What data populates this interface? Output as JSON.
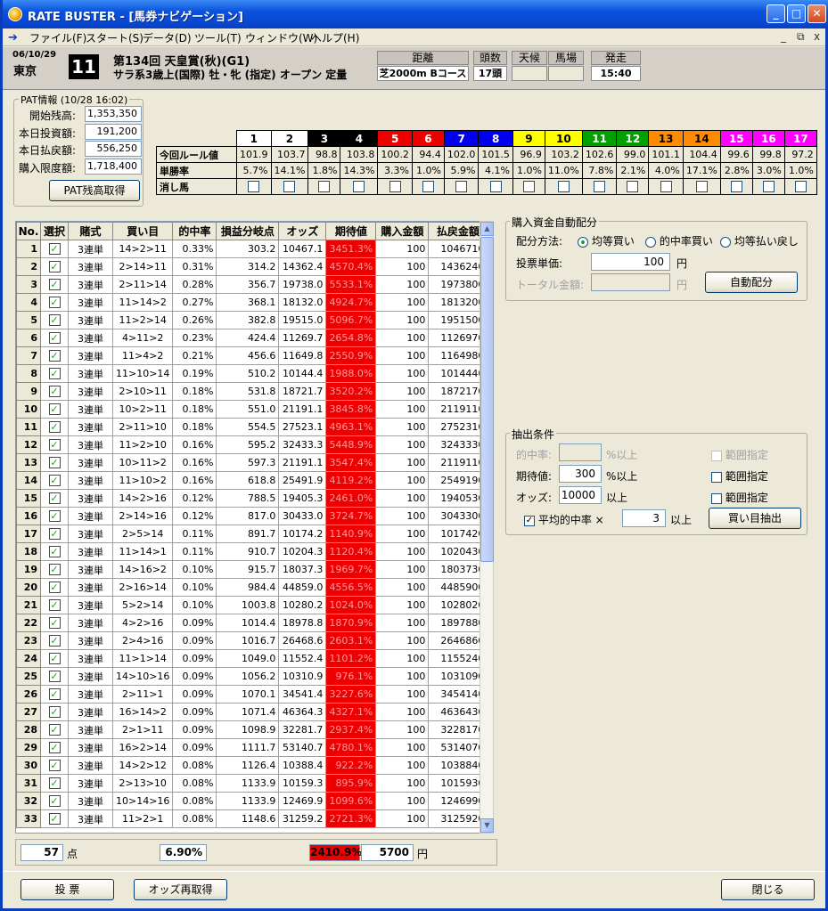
{
  "window": {
    "title": "RATE BUSTER - [馬券ナビゲーション]",
    "min": "_",
    "max": "□",
    "close": "✕"
  },
  "menu": [
    "ファイル(F)",
    "スタート(S)",
    "データ(D)",
    "ツール(T)",
    "ウィンドウ(W)",
    "ヘルプ(H)"
  ],
  "mdi": {
    "min": "_",
    "restore": "⧉",
    "close": "x"
  },
  "race": {
    "date": "06/10/29",
    "place": "東京",
    "number": "11",
    "name": "第134回 天皇賞(秋)(G1)",
    "conditions": "サラ系3歳上(国際) 牡・牝 (指定) オープン 定量",
    "distance_label": "距離",
    "distance": "芝2000m Bコース",
    "heads_label": "頭数",
    "heads": "17頭",
    "weather_label": "天候",
    "weather": "",
    "track_label": "馬場",
    "track": "",
    "start_label": "発走",
    "start": "15:40"
  },
  "pat": {
    "legend": "PAT情報 (10/28 16:02)",
    "rows": [
      {
        "label": "開始残高:",
        "value": "1,353,350"
      },
      {
        "label": "本日投資額:",
        "value": "191,200"
      },
      {
        "label": "本日払戻額:",
        "value": "556,250"
      },
      {
        "label": "購入限度額:",
        "value": "1,718,400"
      }
    ],
    "button": "PAT残高取得"
  },
  "horses": {
    "row_labels": [
      "今回ルール値",
      "単勝率",
      "消し馬"
    ],
    "numbers": [
      "1",
      "2",
      "3",
      "4",
      "5",
      "6",
      "7",
      "8",
      "9",
      "10",
      "11",
      "12",
      "13",
      "14",
      "15",
      "16",
      "17"
    ],
    "colors": [
      "#ffffff",
      "#ffffff",
      "#000000",
      "#000000",
      "#ee0000",
      "#ee0000",
      "#0000ee",
      "#0000ee",
      "#ffff00",
      "#ffff00",
      "#00a000",
      "#00a000",
      "#ff8c00",
      "#ff8c00",
      "#ff00ff",
      "#ff00ff",
      "#ff00ff"
    ],
    "text_colors": [
      "#000000",
      "#000000",
      "#ffffff",
      "#ffffff",
      "#ffffff",
      "#ffffff",
      "#ffffff",
      "#ffffff",
      "#000000",
      "#000000",
      "#ffffff",
      "#ffffff",
      "#000000",
      "#000000",
      "#ffffff",
      "#ffffff",
      "#ffffff"
    ],
    "rule_values": [
      "101.9",
      "103.7",
      "98.8",
      "103.8",
      "100.2",
      "94.4",
      "102.0",
      "101.5",
      "96.9",
      "103.2",
      "102.6",
      "99.0",
      "101.1",
      "104.4",
      "99.6",
      "99.8",
      "97.2"
    ],
    "win_rates": [
      "5.7%",
      "14.1%",
      "1.8%",
      "14.3%",
      "3.3%",
      "1.0%",
      "5.9%",
      "4.1%",
      "1.0%",
      "11.0%",
      "7.8%",
      "2.1%",
      "4.0%",
      "17.1%",
      "2.8%",
      "3.0%",
      "1.0%"
    ]
  },
  "grid": {
    "headers": [
      "No.",
      "選択",
      "賭式",
      "買い目",
      "的中率",
      "損益分岐点",
      "オッズ",
      "期待値",
      "購入金額",
      "払戻金額"
    ],
    "rows": [
      [
        "1",
        "3連単",
        "14>2>11",
        "0.33%",
        "303.2",
        "10467.1",
        "3451.3%",
        "100",
        "1046710"
      ],
      [
        "2",
        "3連単",
        "2>14>11",
        "0.31%",
        "314.2",
        "14362.4",
        "4570.4%",
        "100",
        "1436240"
      ],
      [
        "3",
        "3連単",
        "2>11>14",
        "0.28%",
        "356.7",
        "19738.0",
        "5533.1%",
        "100",
        "1973800"
      ],
      [
        "4",
        "3連単",
        "11>14>2",
        "0.27%",
        "368.1",
        "18132.0",
        "4924.7%",
        "100",
        "1813200"
      ],
      [
        "5",
        "3連単",
        "11>2>14",
        "0.26%",
        "382.8",
        "19515.0",
        "5096.7%",
        "100",
        "1951500"
      ],
      [
        "6",
        "3連単",
        "4>11>2",
        "0.23%",
        "424.4",
        "11269.7",
        "2654.8%",
        "100",
        "1126970"
      ],
      [
        "7",
        "3連単",
        "11>4>2",
        "0.21%",
        "456.6",
        "11649.8",
        "2550.9%",
        "100",
        "1164980"
      ],
      [
        "8",
        "3連単",
        "11>10>14",
        "0.19%",
        "510.2",
        "10144.4",
        "1988.0%",
        "100",
        "1014440"
      ],
      [
        "9",
        "3連単",
        "2>10>11",
        "0.18%",
        "531.8",
        "18721.7",
        "3520.2%",
        "100",
        "1872170"
      ],
      [
        "10",
        "3連単",
        "10>2>11",
        "0.18%",
        "551.0",
        "21191.1",
        "3845.8%",
        "100",
        "2119110"
      ],
      [
        "11",
        "3連単",
        "2>11>10",
        "0.18%",
        "554.5",
        "27523.1",
        "4963.1%",
        "100",
        "2752310"
      ],
      [
        "12",
        "3連単",
        "11>2>10",
        "0.16%",
        "595.2",
        "32433.3",
        "5448.9%",
        "100",
        "3243330"
      ],
      [
        "13",
        "3連単",
        "10>11>2",
        "0.16%",
        "597.3",
        "21191.1",
        "3547.4%",
        "100",
        "2119110"
      ],
      [
        "14",
        "3連単",
        "11>10>2",
        "0.16%",
        "618.8",
        "25491.9",
        "4119.2%",
        "100",
        "2549190"
      ],
      [
        "15",
        "3連単",
        "14>2>16",
        "0.12%",
        "788.5",
        "19405.3",
        "2461.0%",
        "100",
        "1940530"
      ],
      [
        "16",
        "3連単",
        "2>14>16",
        "0.12%",
        "817.0",
        "30433.0",
        "3724.7%",
        "100",
        "3043300"
      ],
      [
        "17",
        "3連単",
        "2>5>14",
        "0.11%",
        "891.7",
        "10174.2",
        "1140.9%",
        "100",
        "1017420"
      ],
      [
        "18",
        "3連単",
        "11>14>1",
        "0.11%",
        "910.7",
        "10204.3",
        "1120.4%",
        "100",
        "1020430"
      ],
      [
        "19",
        "3連単",
        "14>16>2",
        "0.10%",
        "915.7",
        "18037.3",
        "1969.7%",
        "100",
        "1803730"
      ],
      [
        "20",
        "3連単",
        "2>16>14",
        "0.10%",
        "984.4",
        "44859.0",
        "4556.5%",
        "100",
        "4485900"
      ],
      [
        "21",
        "3連単",
        "5>2>14",
        "0.10%",
        "1003.8",
        "10280.2",
        "1024.0%",
        "100",
        "1028020"
      ],
      [
        "22",
        "3連単",
        "4>2>16",
        "0.09%",
        "1014.4",
        "18978.8",
        "1870.9%",
        "100",
        "1897880"
      ],
      [
        "23",
        "3連単",
        "2>4>16",
        "0.09%",
        "1016.7",
        "26468.6",
        "2603.1%",
        "100",
        "2646860"
      ],
      [
        "24",
        "3連単",
        "11>1>14",
        "0.09%",
        "1049.0",
        "11552.4",
        "1101.2%",
        "100",
        "1155240"
      ],
      [
        "25",
        "3連単",
        "14>10>16",
        "0.09%",
        "1056.2",
        "10310.9",
        "976.1%",
        "100",
        "1031090"
      ],
      [
        "26",
        "3連単",
        "2>11>1",
        "0.09%",
        "1070.1",
        "34541.4",
        "3227.6%",
        "100",
        "3454140"
      ],
      [
        "27",
        "3連単",
        "16>14>2",
        "0.09%",
        "1071.4",
        "46364.3",
        "4327.1%",
        "100",
        "4636430"
      ],
      [
        "28",
        "3連単",
        "2>1>11",
        "0.09%",
        "1098.9",
        "32281.7",
        "2937.4%",
        "100",
        "3228170"
      ],
      [
        "29",
        "3連単",
        "16>2>14",
        "0.09%",
        "1111.7",
        "53140.7",
        "4780.1%",
        "100",
        "5314070"
      ],
      [
        "30",
        "3連単",
        "14>2>12",
        "0.08%",
        "1126.4",
        "10388.4",
        "922.2%",
        "100",
        "1038840"
      ],
      [
        "31",
        "3連単",
        "2>13>10",
        "0.08%",
        "1133.9",
        "10159.3",
        "895.9%",
        "100",
        "1015930"
      ],
      [
        "32",
        "3連単",
        "10>14>16",
        "0.08%",
        "1133.9",
        "12469.9",
        "1099.6%",
        "100",
        "1246990"
      ],
      [
        "33",
        "3連単",
        "11>2>1",
        "0.08%",
        "1148.6",
        "31259.2",
        "2721.3%",
        "100",
        "3125920"
      ]
    ]
  },
  "footer": {
    "count": "57",
    "count_unit": "点",
    "hit_rate": "6.90%",
    "expected": "2410.9%",
    "total": "5700",
    "total_unit": "円"
  },
  "alloc": {
    "legend": "購入資金自動配分",
    "method_label": "配分方法:",
    "options": [
      "均等買い",
      "的中率買い",
      "均等払い戻し"
    ],
    "unit_label": "投票単価:",
    "unit_value": "100",
    "unit_yen": "円",
    "total_label": "トータル金額:",
    "total_value": "",
    "total_yen": "円",
    "button": "自動配分"
  },
  "extract": {
    "legend": "抽出条件",
    "hit_label": "的中率:",
    "hit_value": "",
    "hit_suffix": "%以上",
    "hit_range": "範囲指定",
    "exp_label": "期待値:",
    "exp_value": "300",
    "exp_suffix": "%以上",
    "exp_range": "範囲指定",
    "odds_label": "オッズ:",
    "odds_value": "10000",
    "odds_suffix": "以上",
    "odds_range": "範囲指定",
    "avg_label": "平均的中率 ×",
    "avg_value": "3",
    "avg_suffix": "以上",
    "button": "買い目抽出"
  },
  "bottom": {
    "vote": "投 票",
    "reodds": "オッズ再取得",
    "close": "閉じる"
  },
  "colors": {
    "title_blue": "#0a52dc",
    "expected_red": "#ee0000"
  }
}
